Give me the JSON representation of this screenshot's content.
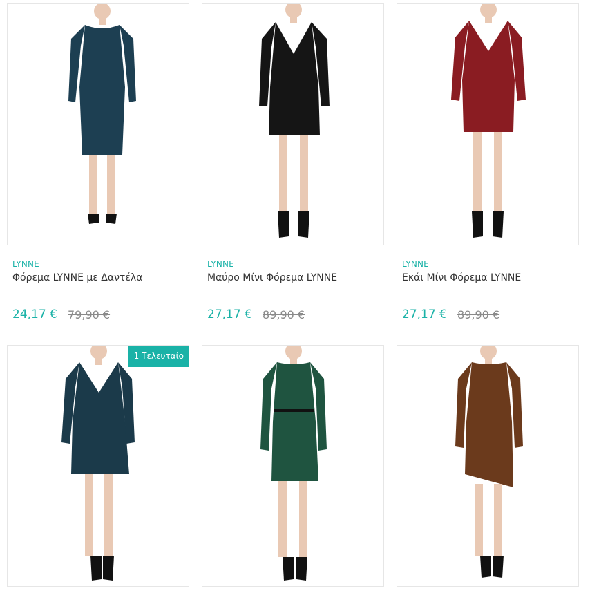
{
  "products": [
    {
      "brand": "LYNNE",
      "title": "Φόρεμα LYNNE με Δαντέλα",
      "price": "24,17 €",
      "old_price": "79,90 €",
      "badge": "",
      "dress_color": "#1d3f52",
      "image": "dress-navy"
    },
    {
      "brand": "LYNNE",
      "title": "Μαύρο Μίνι Φόρεμα LYNNE",
      "price": "27,17 €",
      "old_price": "89,90 €",
      "badge": "",
      "dress_color": "#151515",
      "image": "dress-black"
    },
    {
      "brand": "LYNNE",
      "title": "Εκάι Μίνι Φόρεμα LYNNE",
      "price": "27,17 €",
      "old_price": "89,90 €",
      "badge": "",
      "dress_color": "#8a1c22",
      "image": "dress-red"
    },
    {
      "brand": "",
      "title": "",
      "price": "",
      "old_price": "",
      "badge": "1 Τελευταίο",
      "dress_color": "#1b3a4a",
      "image": "dress-navy-wrap"
    },
    {
      "brand": "",
      "title": "",
      "price": "",
      "old_price": "",
      "badge": "",
      "dress_color": "#1f5440",
      "image": "dress-green"
    },
    {
      "brand": "",
      "title": "",
      "price": "",
      "old_price": "",
      "badge": "",
      "dress_color": "#6b3a1c",
      "image": "dress-brown"
    }
  ],
  "colors": {
    "accent": "#1ab2a7",
    "border": "#e6e6e6",
    "skin": "#e9c9b4"
  }
}
